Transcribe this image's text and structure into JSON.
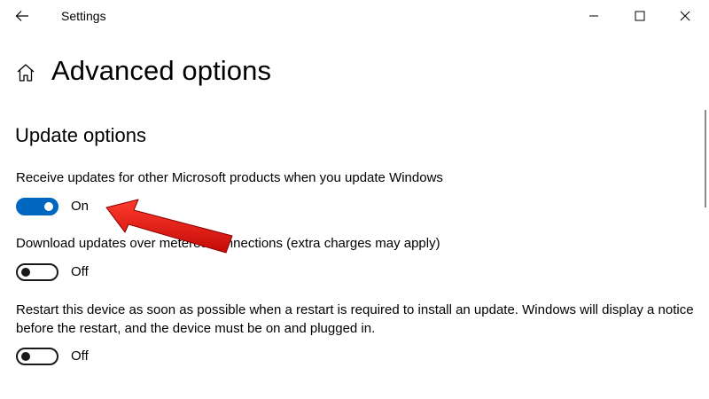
{
  "window": {
    "title": "Settings",
    "controls": {
      "minimize_icon": "minimize-icon",
      "maximize_icon": "maximize-icon",
      "close_icon": "close-icon"
    },
    "back_icon": "back-arrow-icon"
  },
  "page": {
    "title": "Advanced options",
    "home_icon": "home-icon"
  },
  "section": {
    "title": "Update options"
  },
  "options": [
    {
      "label": "Receive updates for other Microsoft products when you update Windows",
      "state": "On",
      "enabled": true
    },
    {
      "label": "Download updates over metered connections (extra charges may apply)",
      "state": "Off",
      "enabled": false
    },
    {
      "label": "Restart this device as soon as possible when a restart is required to install an update. Windows will display a notice before the restart, and the device must be on and plugged in.",
      "state": "Off",
      "enabled": false
    }
  ],
  "colors": {
    "accent": "#0067c0",
    "annotation_arrow": "#e8120c"
  }
}
